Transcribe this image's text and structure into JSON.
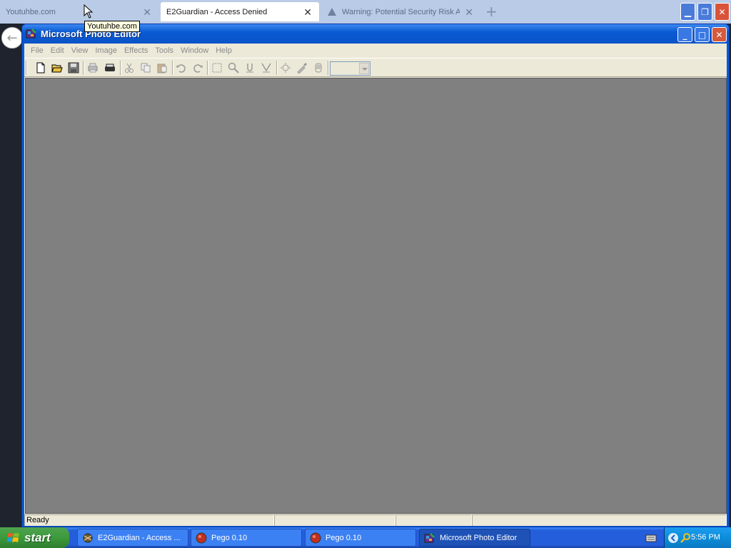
{
  "browser": {
    "tabs": [
      {
        "label": "Youtuhbe.com",
        "active": false
      },
      {
        "label": "E2Guardian - Access Denied",
        "active": true
      },
      {
        "label": "Warning: Potential Security Risk Ah",
        "active": false
      }
    ],
    "tooltip": "Youtuhbe.com"
  },
  "photo_editor": {
    "title": "Microsoft Photo Editor",
    "menu": [
      "File",
      "Edit",
      "View",
      "Image",
      "Effects",
      "Tools",
      "Window",
      "Help"
    ],
    "toolbar": [
      "new-icon",
      "open-icon",
      "save-icon",
      "print-icon",
      "scan-icon",
      "cut-icon",
      "copy-icon",
      "paste-icon",
      "undo-icon",
      "redo-icon",
      "select-icon",
      "zoom-icon",
      "smudge-icon",
      "sharpen-icon",
      "transparent-icon",
      "eyedropper-icon",
      "pan-icon"
    ],
    "zoom_value": "",
    "status": [
      "Ready",
      "",
      "",
      ""
    ]
  },
  "taskbar": {
    "start_label": "start",
    "tasks": [
      {
        "label": "E2Guardian - Access ...",
        "icon": "browser-icon",
        "active": false
      },
      {
        "label": "Pego 0.10",
        "icon": "pego-icon",
        "active": false
      },
      {
        "label": "Pego 0.10",
        "icon": "pego-icon",
        "active": false
      },
      {
        "label": "Microsoft Photo Editor",
        "icon": "photo-editor-icon",
        "active": true
      }
    ],
    "clock": "5:56 PM"
  },
  "colors": {
    "titlebar": "#0a5ad3",
    "taskbar": "#245edb",
    "start": "#3c9a3c",
    "workspace": "#808080",
    "window_face": "#ece9d8"
  }
}
